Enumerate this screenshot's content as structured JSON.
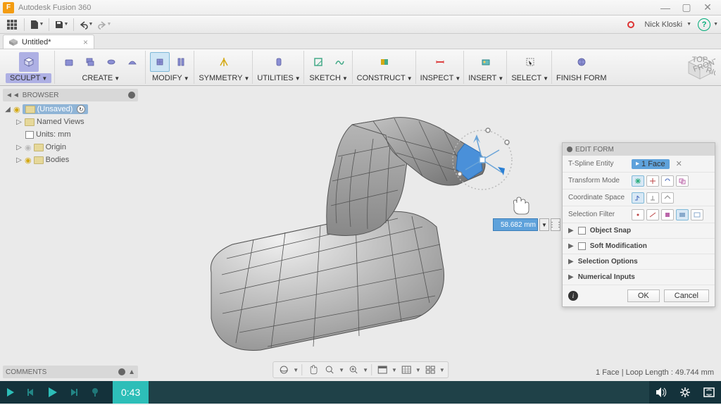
{
  "app": {
    "title": "Autodesk Fusion 360"
  },
  "qat": {
    "user": "Nick Kloski"
  },
  "doc": {
    "tab": "Untitled*"
  },
  "ribbon": {
    "sculpt": "SCULPT",
    "create": "CREATE",
    "modify": "MODIFY",
    "symmetry": "SYMMETRY",
    "utilities": "UTILITIES",
    "sketch": "SKETCH",
    "construct": "CONSTRUCT",
    "inspect": "INSPECT",
    "insert": "INSERT",
    "select": "SELECT",
    "finish": "FINISH FORM"
  },
  "browser": {
    "title": "BROWSER",
    "unsaved": "(Unsaved)",
    "named_views": "Named Views",
    "units": "Units: mm",
    "origin": "Origin",
    "bodies": "Bodies"
  },
  "comments": {
    "title": "COMMENTS"
  },
  "editform": {
    "title": "EDIT FORM",
    "entity_label": "T-Spline Entity",
    "entity_value": "1 Face",
    "transform_label": "Transform Mode",
    "coord_label": "Coordinate Space",
    "filter_label": "Selection Filter",
    "snap": "Object Snap",
    "softmod": "Soft Modification",
    "selopt": "Selection Options",
    "numinput": "Numerical Inputs",
    "ok": "OK",
    "cancel": "Cancel"
  },
  "valbox": {
    "value": "58.682 mm"
  },
  "status": {
    "text": "1 Face | Loop Length : 49.744 mm"
  },
  "player": {
    "time": "0:43"
  }
}
